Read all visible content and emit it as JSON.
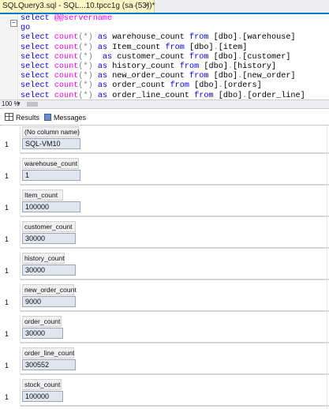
{
  "tab": {
    "title": "SQLQuery3.sql - SQL...10.tpcc1g (sa (53))*",
    "pin": "⊣",
    "close": "✕"
  },
  "editor": {
    "collapse_glyph": "−",
    "lines": [
      [
        {
          "t": "select ",
          "c": "kw"
        },
        {
          "t": "@@servername",
          "c": "sv"
        }
      ],
      [
        {
          "t": "go",
          "c": "kw"
        }
      ],
      [
        {
          "t": "select ",
          "c": "kw"
        },
        {
          "t": "count",
          "c": "fn"
        },
        {
          "t": "(*)",
          "c": "gray"
        },
        {
          "t": " as ",
          "c": "kw"
        },
        {
          "t": "warehouse_count ",
          "c": ""
        },
        {
          "t": "from ",
          "c": "kw"
        },
        {
          "t": "[dbo]",
          "c": ""
        },
        {
          "t": ".",
          "c": "gray"
        },
        {
          "t": "[warehouse]",
          "c": ""
        }
      ],
      [
        {
          "t": "select ",
          "c": "kw"
        },
        {
          "t": "count",
          "c": "fn"
        },
        {
          "t": "(*)",
          "c": "gray"
        },
        {
          "t": " as ",
          "c": "kw"
        },
        {
          "t": "Item_count ",
          "c": ""
        },
        {
          "t": "from ",
          "c": "kw"
        },
        {
          "t": "[dbo]",
          "c": ""
        },
        {
          "t": ".",
          "c": "gray"
        },
        {
          "t": "[item]",
          "c": ""
        }
      ],
      [
        {
          "t": "select ",
          "c": "kw"
        },
        {
          "t": "count",
          "c": "fn"
        },
        {
          "t": "(*)",
          "c": "gray"
        },
        {
          "t": "  as ",
          "c": "kw"
        },
        {
          "t": "customer_count ",
          "c": ""
        },
        {
          "t": "from ",
          "c": "kw"
        },
        {
          "t": "[dbo]",
          "c": ""
        },
        {
          "t": ".",
          "c": "gray"
        },
        {
          "t": "[customer]",
          "c": ""
        }
      ],
      [
        {
          "t": "select ",
          "c": "kw"
        },
        {
          "t": "count",
          "c": "fn"
        },
        {
          "t": "(*)",
          "c": "gray"
        },
        {
          "t": " as ",
          "c": "kw"
        },
        {
          "t": "history_count ",
          "c": ""
        },
        {
          "t": "from ",
          "c": "kw"
        },
        {
          "t": "[dbo]",
          "c": ""
        },
        {
          "t": ".",
          "c": "gray"
        },
        {
          "t": "[history]",
          "c": ""
        }
      ],
      [
        {
          "t": "select ",
          "c": "kw"
        },
        {
          "t": "count",
          "c": "fn"
        },
        {
          "t": "(*)",
          "c": "gray"
        },
        {
          "t": " as ",
          "c": "kw"
        },
        {
          "t": "new_order_count ",
          "c": ""
        },
        {
          "t": "from ",
          "c": "kw"
        },
        {
          "t": "[dbo]",
          "c": ""
        },
        {
          "t": ".",
          "c": "gray"
        },
        {
          "t": "[new_order]",
          "c": ""
        }
      ],
      [
        {
          "t": "select ",
          "c": "kw"
        },
        {
          "t": "count",
          "c": "fn"
        },
        {
          "t": "(*)",
          "c": "gray"
        },
        {
          "t": " as ",
          "c": "kw"
        },
        {
          "t": "order_count ",
          "c": ""
        },
        {
          "t": "from ",
          "c": "kw"
        },
        {
          "t": "[dbo]",
          "c": ""
        },
        {
          "t": ".",
          "c": "gray"
        },
        {
          "t": "[orders]",
          "c": ""
        }
      ],
      [
        {
          "t": "select ",
          "c": "kw"
        },
        {
          "t": "count",
          "c": "fn"
        },
        {
          "t": "(*)",
          "c": "gray"
        },
        {
          "t": " as ",
          "c": "kw"
        },
        {
          "t": "order_line_count ",
          "c": ""
        },
        {
          "t": "from ",
          "c": "kw"
        },
        {
          "t": "[dbo]",
          "c": ""
        },
        {
          "t": ".",
          "c": "gray"
        },
        {
          "t": "[order_line]",
          "c": ""
        }
      ]
    ]
  },
  "status": {
    "zoom": "100 %",
    "zoom_arrow": "▾"
  },
  "result_tabs": {
    "results": "Results",
    "messages": "Messages"
  },
  "grids": [
    {
      "header": "(No column name)",
      "row": "1",
      "value": "SQL-VM10"
    },
    {
      "header": "warehouse_count",
      "row": "1",
      "value": "1"
    },
    {
      "header": "Item_count",
      "row": "1",
      "value": "100000"
    },
    {
      "header": "customer_count",
      "row": "1",
      "value": "30000"
    },
    {
      "header": "history_count",
      "row": "1",
      "value": "30000"
    },
    {
      "header": "new_order_count",
      "row": "1",
      "value": "9000"
    },
    {
      "header": "order_count",
      "row": "1",
      "value": "30000"
    },
    {
      "header": "order_line_count",
      "row": "1",
      "value": "300552"
    },
    {
      "header": "stock_count",
      "row": "1",
      "value": "100000"
    }
  ]
}
